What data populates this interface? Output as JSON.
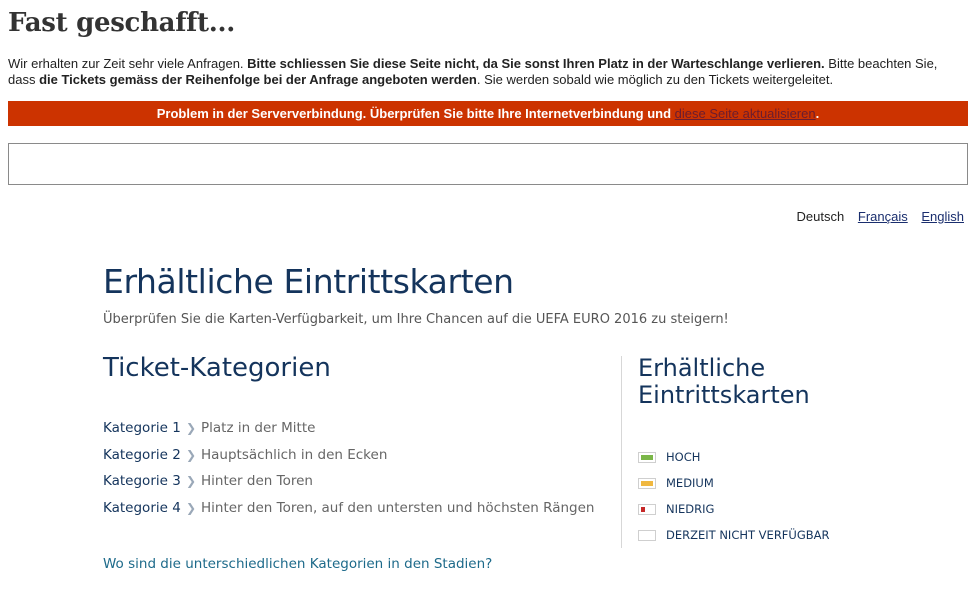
{
  "header": {
    "title": "Fast geschafft...",
    "intro_1": "Wir erhalten zur Zeit sehr viele Anfragen. ",
    "intro_2": "Bitte schliessen Sie diese Seite nicht, da Sie sonst Ihren Platz in der Warteschlange verlieren.",
    "intro_3": " Bitte beachten Sie, dass ",
    "intro_4": "die Tickets gemäss der Reihenfolge bei der Anfrage angeboten werden",
    "intro_5": ". Sie werden sobald wie möglich zu den Tickets weitergeleitet."
  },
  "error": {
    "message": "Problem in der Serververbindung. Überprüfen Sie bitte Ihre Internetverbindung und ",
    "link": "diese Seite aktualisieren",
    "suffix": ".",
    "color": "#cc3300"
  },
  "languages": {
    "current": "Deutsch",
    "french": "Français",
    "english": "English"
  },
  "main": {
    "title": "Erhältliche Eintrittskarten",
    "subtitle": "Überprüfen Sie die Karten-Verfügbarkeit, um Ihre Chancen auf die UEFA EURO 2016 zu steigern!"
  },
  "categories": {
    "heading": "Ticket-Kategorien",
    "chevron_icon": "chevron-right-icon",
    "items": [
      {
        "name": "Kategorie 1",
        "desc": "Platz in der Mitte"
      },
      {
        "name": "Kategorie 2",
        "desc": "Hauptsächlich in den Ecken"
      },
      {
        "name": "Kategorie 3",
        "desc": "Hinter den Toren"
      },
      {
        "name": "Kategorie 4",
        "desc": "Hinter den Toren, auf den untersten und höchsten Rängen"
      }
    ],
    "stadium_link": "Wo sind die unterschiedlichen Kategorien in den Stadien?"
  },
  "availability": {
    "heading_line1": "Erhältliche",
    "heading_line2": "Eintrittskarten",
    "legend": [
      {
        "label": "HOCH",
        "color": "#7ab648",
        "level": 1.0
      },
      {
        "label": "MEDIUM",
        "color": "#f0b840",
        "level": 1.0
      },
      {
        "label": "NIEDRIG",
        "color": "#c62828",
        "level": 0.35
      },
      {
        "label": "DERZEIT NICHT VERFÜGBAR",
        "color": "#ffffff",
        "level": 0
      }
    ]
  }
}
